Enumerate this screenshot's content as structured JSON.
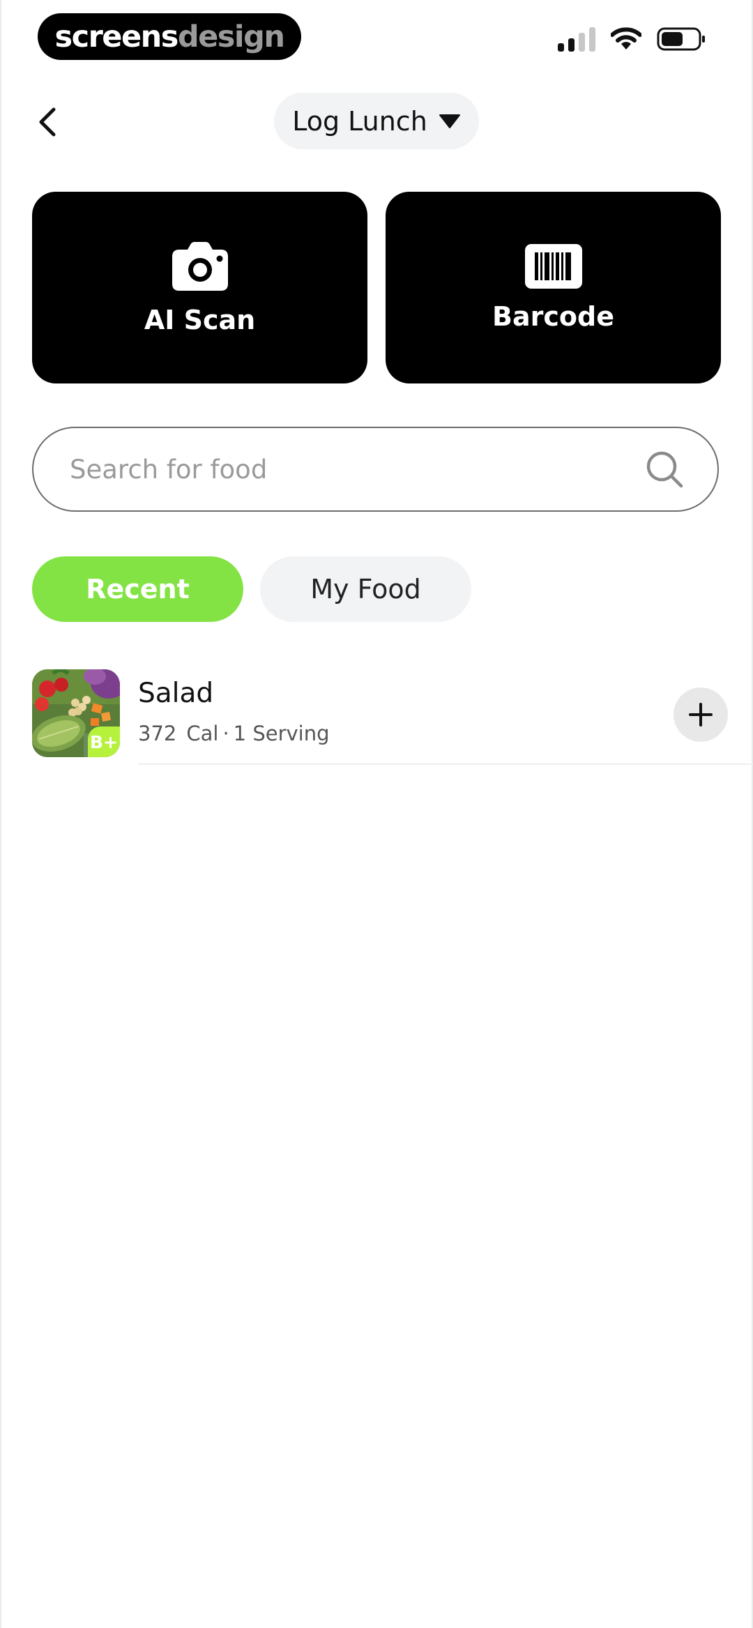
{
  "status_bar": {
    "brand_part1": "screens",
    "brand_part2": "design",
    "icons": [
      "cellular-signal-icon",
      "wifi-icon",
      "battery-icon"
    ]
  },
  "header": {
    "back_icon": "chevron-left-icon",
    "meal_label": "Log Lunch",
    "dropdown_icon": "triangle-down-icon"
  },
  "actions": {
    "scan_label": "AI Scan",
    "scan_icon": "camera-icon",
    "barcode_label": "Barcode",
    "barcode_icon": "barcode-icon"
  },
  "search": {
    "placeholder": "Search for food",
    "value": "",
    "icon": "search-icon"
  },
  "tabs": [
    {
      "label": "Recent",
      "active": true
    },
    {
      "label": "My Food",
      "active": false
    }
  ],
  "food_items": [
    {
      "name": "Salad",
      "calories": "372",
      "calorie_unit": "Cal",
      "separator": "·",
      "serving": "1 Serving",
      "grade": "B+",
      "add_icon": "plus-icon"
    }
  ],
  "colors": {
    "accent_green": "#84e344",
    "grade_green": "#b6f23c",
    "card_black": "#000000",
    "chip_grey": "#f2f3f5"
  }
}
